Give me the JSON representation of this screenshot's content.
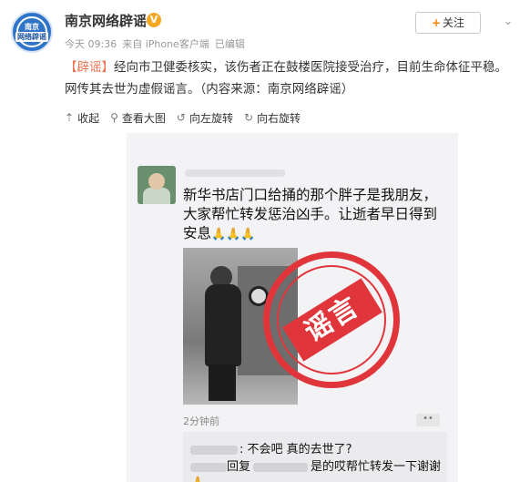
{
  "account": {
    "avatar_text_top": "南京",
    "avatar_text_bottom": "网络辟谣",
    "name": "南京网络辟谣",
    "verified_badge": "V",
    "time": "今天 09:36",
    "source": "来自 iPhone客户端",
    "edited": "已编辑"
  },
  "actions": {
    "follow_plus": "+",
    "follow_label": "关注",
    "more_icon": "chevron-down-icon"
  },
  "post": {
    "tag": "【辟谣】",
    "body": "经向市卫健委核实，该伤者正在鼓楼医院接受治疗，目前生命体征平稳。网传其去世为虚假谣言。",
    "source_note": "（内容来源：南京网络辟谣）"
  },
  "toolbar": {
    "collapse": "收起",
    "view_large": "查看大图",
    "rotate_left": "向左旋转",
    "rotate_right": "向右旋转"
  },
  "screenshot": {
    "post_text": "新华书店门口给捅的那个胖子是我朋友，大家帮忙转发惩治凶手。让逝者早日得到安息",
    "emoji": "🙏🙏🙏",
    "stamp_text": "谣言",
    "time": "2分钟前",
    "more": "••",
    "comment1": ": 不会吧 真的去世了?",
    "comment2_reply": "回复",
    "comment2_text": "是的哎帮忙转发一下谢谢🙏"
  }
}
